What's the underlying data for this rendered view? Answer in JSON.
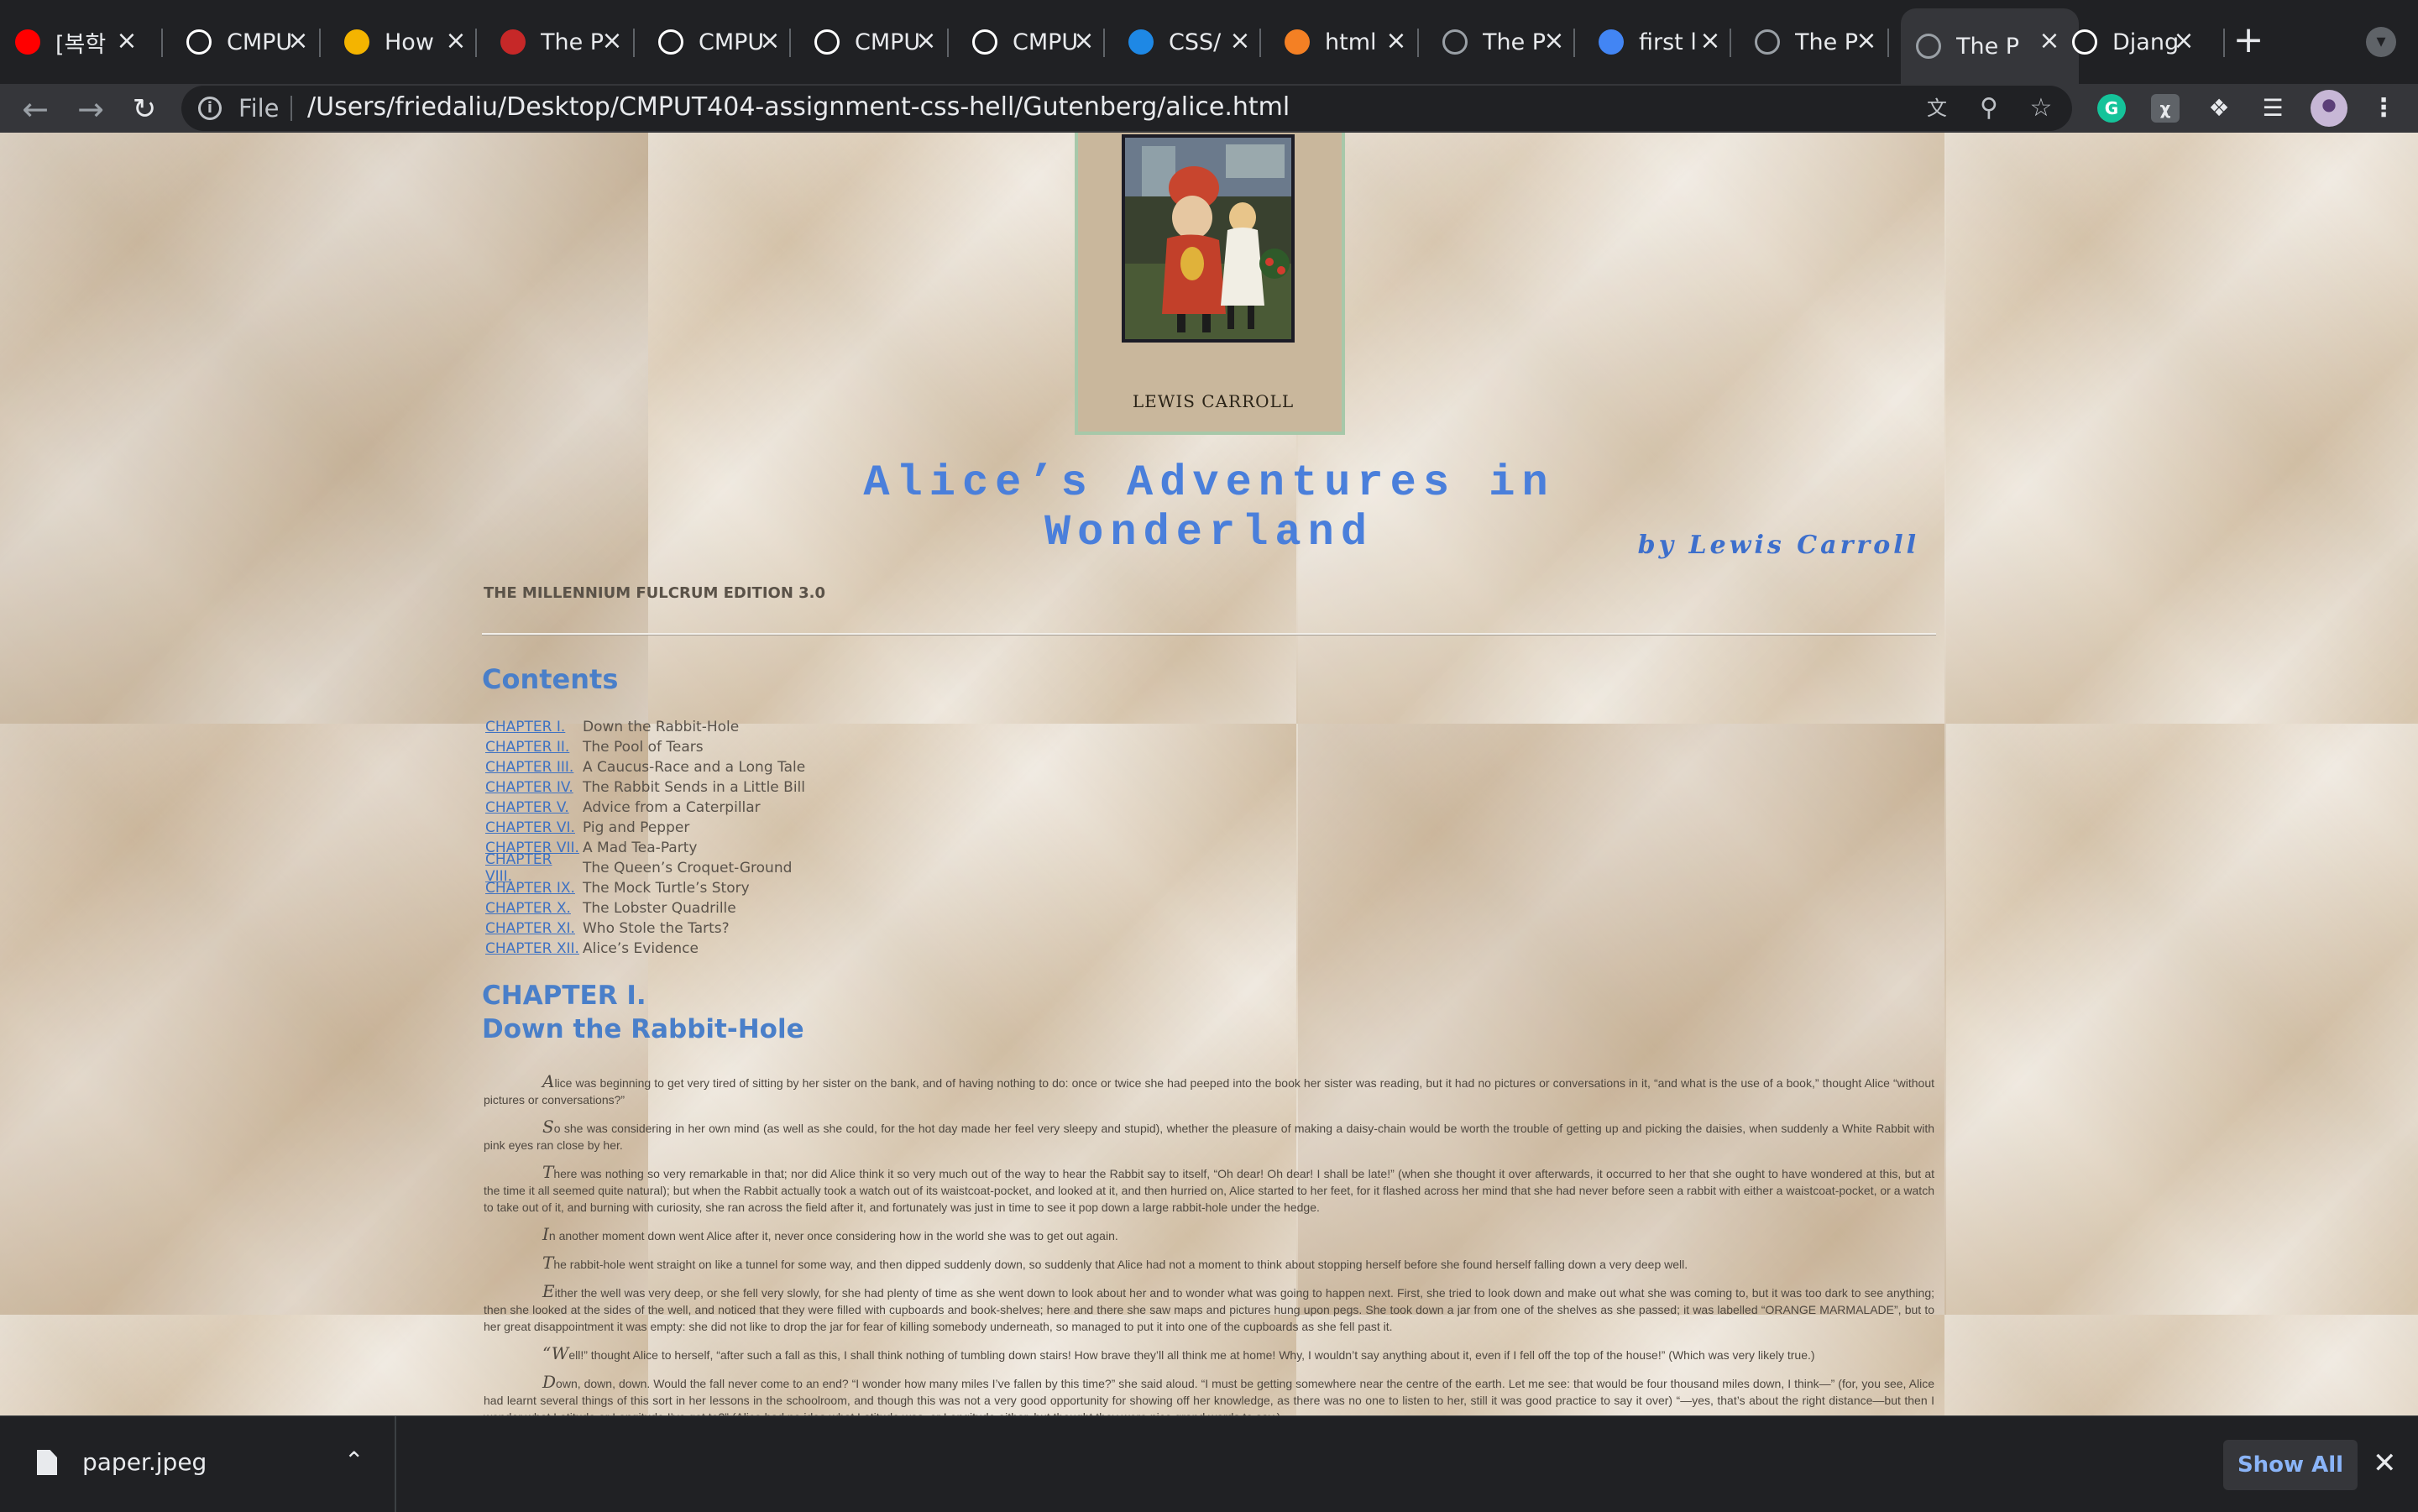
{
  "browser": {
    "tabs": [
      {
        "title": "[복학",
        "favicon": "youtube-icon",
        "fav_color": "#ff0000",
        "active": false
      },
      {
        "title": "CMPU",
        "favicon": "github-icon",
        "fav_color": "#ffffff",
        "active": false
      },
      {
        "title": "How",
        "favicon": "colorful-icon",
        "fav_color": "#f4b400",
        "active": false
      },
      {
        "title": "The P",
        "favicon": "gutenberg-icon",
        "fav_color": "#c62828",
        "active": false
      },
      {
        "title": "CMPU",
        "favicon": "github-icon",
        "fav_color": "#ffffff",
        "active": false
      },
      {
        "title": "CMPU",
        "favicon": "github-icon",
        "fav_color": "#ffffff",
        "active": false
      },
      {
        "title": "CMPU",
        "favicon": "github-icon",
        "fav_color": "#ffffff",
        "active": false
      },
      {
        "title": "CSS/",
        "favicon": "w3schools-icon",
        "fav_color": "#1e88e5",
        "active": false
      },
      {
        "title": "html",
        "favicon": "stackoverflow-icon",
        "fav_color": "#f48024",
        "active": false
      },
      {
        "title": "The P",
        "favicon": "globe-icon",
        "fav_color": "#9aa0a6",
        "active": false
      },
      {
        "title": "first l",
        "favicon": "google-icon",
        "fav_color": "#4285f4",
        "active": false
      },
      {
        "title": "The P",
        "favicon": "globe-icon",
        "fav_color": "#9aa0a6",
        "active": false
      },
      {
        "title": "The P",
        "favicon": "globe-icon",
        "fav_color": "#9aa0a6",
        "active": true
      },
      {
        "title": "Djang",
        "favicon": "medium-icon",
        "fav_color": "#ffffff",
        "active": false
      }
    ],
    "address": {
      "scheme_label": "File",
      "url": "/Users/friedaliu/Desktop/CMPUT404-assignment-css-hell/Gutenberg/alice.html"
    },
    "download": {
      "filename": "paper.jpeg",
      "show_all_label": "Show All"
    }
  },
  "page": {
    "cover_author": "LEWIS CARROLL",
    "title": "Alice’s Adventures in Wonderland",
    "byline": "by Lewis Carroll",
    "edition": "THE MILLENNIUM FULCRUM EDITION 3.0",
    "contents_heading": "Contents",
    "toc": [
      {
        "link": "CHAPTER I.",
        "title": "Down the Rabbit-Hole"
      },
      {
        "link": "CHAPTER II.",
        "title": "The Pool of Tears"
      },
      {
        "link": "CHAPTER III.",
        "title": "A Caucus-Race and a Long Tale"
      },
      {
        "link": "CHAPTER IV.",
        "title": "The Rabbit Sends in a Little Bill"
      },
      {
        "link": "CHAPTER V.",
        "title": "Advice from a Caterpillar"
      },
      {
        "link": "CHAPTER VI.",
        "title": "Pig and Pepper"
      },
      {
        "link": "CHAPTER VII.",
        "title": "A Mad Tea-Party"
      },
      {
        "link": "CHAPTER VIII.",
        "title": "The Queen’s Croquet-Ground"
      },
      {
        "link": "CHAPTER IX.",
        "title": "The Mock Turtle’s Story"
      },
      {
        "link": "CHAPTER X.",
        "title": "The Lobster Quadrille"
      },
      {
        "link": "CHAPTER XI.",
        "title": "Who Stole the Tarts?"
      },
      {
        "link": "CHAPTER XII.",
        "title": "Alice’s Evidence"
      }
    ],
    "chapter_number": "CHAPTER I.",
    "chapter_title": "Down the Rabbit-Hole",
    "paragraphs": [
      "Alice was beginning to get very tired of sitting by her sister on the bank, and of having nothing to do: once or twice she had peeped into the book her sister was reading, but it had no pictures or conversations in it, “and what is the use of a book,” thought Alice “without pictures or conversations?”",
      "So she was considering in her own mind (as well as she could, for the hot day made her feel very sleepy and stupid), whether the pleasure of making a daisy-chain would be worth the trouble of getting up and picking the daisies, when suddenly a White Rabbit with pink eyes ran close by her.",
      "There was nothing so very remarkable in that; nor did Alice think it so very much out of the way to hear the Rabbit say to itself, “Oh dear! Oh dear! I shall be late!” (when she thought it over afterwards, it occurred to her that she ought to have wondered at this, but at the time it all seemed quite natural); but when the Rabbit actually took a watch out of its waistcoat-pocket, and looked at it, and then hurried on, Alice started to her feet, for it flashed across her mind that she had never before seen a rabbit with either a waistcoat-pocket, or a watch to take out of it, and burning with curiosity, she ran across the field after it, and fortunately was just in time to see it pop down a large rabbit-hole under the hedge.",
      "In another moment down went Alice after it, never once considering how in the world she was to get out again.",
      "The rabbit-hole went straight on like a tunnel for some way, and then dipped suddenly down, so suddenly that Alice had not a moment to think about stopping herself before she found herself falling down a very deep well.",
      "Either the well was very deep, or she fell very slowly, for she had plenty of time as she went down to look about her and to wonder what was going to happen next. First, she tried to look down and make out what she was coming to, but it was too dark to see anything; then she looked at the sides of the well, and noticed that they were filled with cupboards and book-shelves; here and there she saw maps and pictures hung upon pegs. She took down a jar from one of the shelves as she passed; it was labelled “ORANGE MARMALADE”, but to her great disappointment it was empty: she did not like to drop the jar for fear of killing somebody underneath, so managed to put it into one of the cupboards as she fell past it.",
      "“Well!” thought Alice to herself, “after such a fall as this, I shall think nothing of tumbling down stairs! How brave they’ll all think me at home! Why, I wouldn’t say anything about it, even if I fell off the top of the house!” (Which was very likely true.)",
      "Down, down, down. Would the fall never come to an end? “I wonder how many miles I’ve fallen by this time?” she said aloud. “I must be getting somewhere near the centre of the earth. Let me see: that would be four thousand miles down, I think—” (for, you see, Alice had learnt several things of this sort in her lessons in the schoolroom, and though this was not a very good opportunity for showing off her knowledge, as there was no one to listen to her, still it was good practice to say it over) “—yes, that’s about the right distance—but then I wonder what Latitude or Longitude I’ve got to?” (Alice had no idea what Latitude was, or Longitude either, but thought they were nice grand words to say.)"
    ]
  }
}
